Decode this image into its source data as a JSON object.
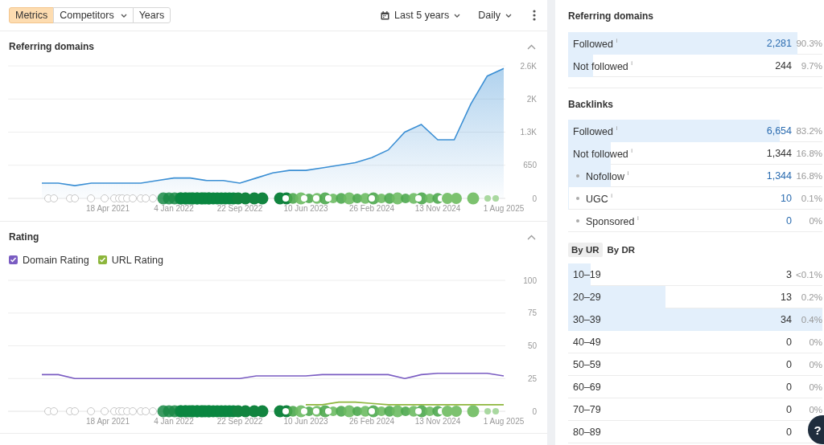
{
  "toolbar": {
    "tabs": [
      {
        "label": "Metrics",
        "selected": true,
        "dropdown": false
      },
      {
        "label": "Competitors",
        "selected": false,
        "dropdown": true
      },
      {
        "label": "Years",
        "selected": false,
        "dropdown": false
      }
    ],
    "date_range": "Last 5 years",
    "interval": "Daily"
  },
  "sections": [
    {
      "title": "Referring domains",
      "expanded": true,
      "chart_data": {
        "type": "area",
        "grid": true,
        "ylim": [
          0,
          2600
        ],
        "categories": [
          null,
          null,
          null,
          null,
          "18 Apr 2021",
          null,
          null,
          null,
          "4 Jan 2022",
          null,
          null,
          null,
          "22 Sep 2022",
          null,
          null,
          null,
          "10 Jun 2023",
          null,
          null,
          null,
          "26 Feb 2024",
          null,
          null,
          null,
          "13 Nov 2024",
          null,
          null,
          null,
          "1 Aug 2025"
        ],
        "yticks": [
          {
            "value": 0,
            "label": "0"
          },
          {
            "value": 650,
            "label": "650"
          },
          {
            "value": 1300,
            "label": "1.3K"
          },
          {
            "value": 1950,
            "label": "2K"
          },
          {
            "value": 2600,
            "label": "2.6K"
          }
        ],
        "series": [
          {
            "color": "#3b8fd4",
            "values": [
              300,
              300,
              250,
              300,
              300,
              300,
              300,
              350,
              400,
              400,
              350,
              350,
              300,
              400,
              500,
              550,
              550,
              600,
              650,
              700,
              800,
              950,
              1300,
              1450,
              1150,
              1150,
              1850,
              2400,
              2550
            ]
          }
        ]
      }
    },
    {
      "title": "Rating",
      "expanded": true,
      "legend": [
        {
          "checked": true,
          "color": "#7a5cc2"
        },
        {
          "checked": true,
          "color": "#8db63c"
        }
      ],
      "chart_data": {
        "type": "line",
        "grid": true,
        "ylim": [
          0,
          100
        ],
        "categories": [
          null,
          null,
          null,
          null,
          "18 Apr 2021",
          null,
          null,
          null,
          "4 Jan 2022",
          null,
          null,
          null,
          "22 Sep 2022",
          null,
          null,
          null,
          "10 Jun 2023",
          null,
          null,
          null,
          "26 Feb 2024",
          null,
          null,
          null,
          "13 Nov 2024",
          null,
          null,
          null,
          "1 Aug 2025"
        ],
        "yticks": [
          0,
          25,
          50,
          75,
          100
        ],
        "series": [
          {
            "name": "Domain Rating",
            "color": "#7a5cc2",
            "values": [
              28,
              28,
              25,
              25,
              25,
              25,
              25,
              25,
              25,
              25,
              25,
              25,
              25,
              27,
              27,
              27,
              27,
              28,
              28,
              28,
              28,
              28,
              25,
              28,
              29,
              29,
              29,
              29,
              27
            ]
          },
          {
            "name": "URL Rating",
            "color": "#8db63c",
            "values": [
              null,
              null,
              null,
              null,
              null,
              null,
              null,
              null,
              null,
              null,
              null,
              null,
              null,
              null,
              null,
              null,
              5,
              5,
              7,
              7,
              6,
              5,
              5,
              5,
              5,
              5,
              5,
              5,
              5
            ]
          }
        ]
      }
    }
  ],
  "summary": [
    {
      "title": "Referring domains",
      "rows": [
        {
          "kind": "main",
          "label": "Followed $^{i}$",
          "value": "2,281",
          "percent": "90.3%",
          "level": 0.903,
          "linked": true
        },
        {
          "kind": "main",
          "label": "Not followed $^{i}$",
          "value": "244",
          "percent": "9.7%",
          "level": 0.097,
          "linked": false
        }
      ]
    },
    {
      "title": "Backlinks",
      "rows": [
        {
          "kind": "main",
          "label": "Followed $^{i}$",
          "value": "6,654",
          "percent": "83.2%",
          "level": 0.832,
          "linked": true
        },
        {
          "kind": "main",
          "label": "Not followed $^{i}$",
          "value": "1,344",
          "percent": "16.8%",
          "level": 0.168,
          "linked": false
        },
        {
          "kind": "sub",
          "label": "Nofollow $^{i}$",
          "value": "1,344",
          "percent": "16.8%",
          "level": 0.168,
          "linked": true
        },
        {
          "kind": "sub",
          "label": "UGC $^{i}$",
          "value": "10",
          "percent": "0.1%",
          "level": 0.001,
          "linked": true
        },
        {
          "kind": "sub",
          "label": "Sponsored $^{i}$",
          "value": "0",
          "percent": "0%",
          "level": 0,
          "linked": true
        }
      ]
    }
  ],
  "ur_tabs": [
    {
      "label": "By UR",
      "selected": true
    },
    {
      "label": "By DR",
      "selected": false
    }
  ],
  "ur_rows": [
    {
      "label": "10–19",
      "value": "3",
      "percent": "<0.1%",
      "level": 0.088
    },
    {
      "label": "20–29",
      "value": "13",
      "percent": "0.2%",
      "level": 0.382
    },
    {
      "label": "30–39",
      "value": "34",
      "percent": "0.4%",
      "level": 1
    },
    {
      "label": "40–49",
      "value": "0",
      "percent": "0%",
      "level": 0
    },
    {
      "label": "50–59",
      "value": "0",
      "percent": "0%",
      "level": 0
    },
    {
      "label": "60–69",
      "value": "0",
      "percent": "0%",
      "level": 0
    },
    {
      "label": "70–79",
      "value": "0",
      "percent": "0%",
      "level": 0
    },
    {
      "label": "80–89",
      "value": "0",
      "level": 0
    }
  ],
  "help_button": "?"
}
